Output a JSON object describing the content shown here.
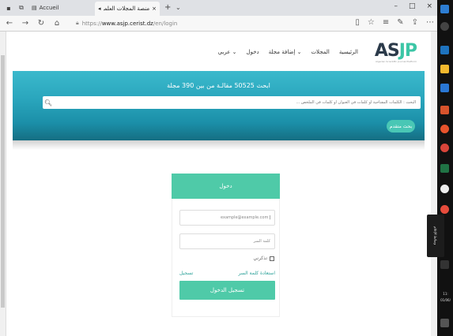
{
  "browser": {
    "tab_inactive_label": "Accueil",
    "tab_active_title": "منصة المجلات العلمية الج",
    "url_prefix": "https://",
    "url_host": "www.asjp.cerist.dz",
    "url_path": "/en/login",
    "window_controls": [
      "–",
      "□",
      "×"
    ]
  },
  "site": {
    "logo_as": "AS",
    "logo_jp": "JP",
    "logo_subtitle": "Algerian Scientific Journal Platform",
    "menu": [
      "الرئيسية",
      "المجلات",
      "إضافة مجلة ⌄",
      "دخول",
      "عربي ⌄"
    ]
  },
  "hero": {
    "title": "ابحث 50525 مقالـة من بين 390 مجلة",
    "search_placeholder": "البحث : الكلمات المفتاحية أو كلمات في العنوان أو كلمات في الملخص ...",
    "advanced_button": "بحث متقدم"
  },
  "login": {
    "header": "دخول",
    "email_value": "example@example.com",
    "password_placeholder": "كلمة السر",
    "remember_label": "تذكرني",
    "forgot_label": "استعادة كلمة السر",
    "register_label": "تسجيل",
    "submit_label": "تسجيل الدخول"
  },
  "taskbar": {
    "side_panel_label": "وسائط الإعلام",
    "time_fragment": "11:",
    "date_fragment": "01/06/"
  },
  "colors": {
    "accent": "#4fcaa8",
    "hero_top": "#3bb9cc",
    "hero_bottom": "#156e82",
    "logo_dark": "#2b3a4a",
    "logo_accent": "#3cc6a6"
  }
}
